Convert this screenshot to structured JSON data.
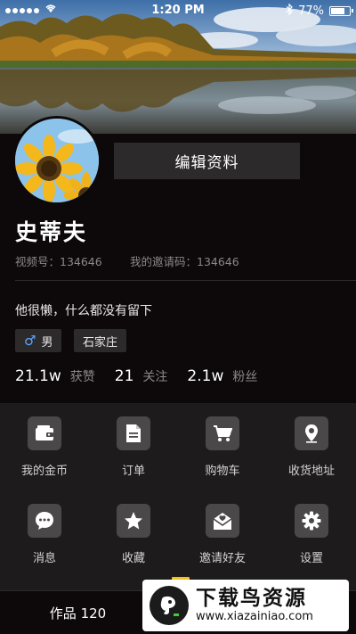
{
  "status_bar": {
    "time": "1:20 PM",
    "battery_text": "77%",
    "battery_level": 0.77,
    "icons": [
      "signal-icon",
      "wifi-icon",
      "bluetooth-icon",
      "battery-icon"
    ]
  },
  "profile": {
    "edit_button_label": "编辑资料",
    "username": "史蒂夫",
    "video_id": "视频号：134646",
    "invite_code": "我的邀请码：134646",
    "bio": "他很懒，什么都没有留下",
    "gender_label": "男",
    "city": "石家庄"
  },
  "stats": [
    {
      "value": "21.1w",
      "label": "获赞"
    },
    {
      "value": "21",
      "label": "关注"
    },
    {
      "value": "2.1w",
      "label": "粉丝"
    }
  ],
  "grid": [
    {
      "label": "我的金币",
      "icon": "wallet-icon"
    },
    {
      "label": "订单",
      "icon": "document-icon"
    },
    {
      "label": "购物车",
      "icon": "cart-icon"
    },
    {
      "label": "收货地址",
      "icon": "location-pin-icon"
    },
    {
      "label": "消息",
      "icon": "chat-bubble-icon"
    },
    {
      "label": "收藏",
      "icon": "star-icon"
    },
    {
      "label": "邀请好友",
      "icon": "invite-envelope-icon"
    },
    {
      "label": "设置",
      "icon": "gear-icon"
    }
  ],
  "tabs": {
    "works_label": "作品 120"
  },
  "watermark": {
    "title": "下载鸟资源",
    "url": "www.xiazainiao.com"
  },
  "colors": {
    "background": "#0d090b",
    "panel": "#1d1b1c",
    "icon_tile": "#4a4849",
    "accent": "#f3c11b",
    "gender_blue": "#5aa7ff"
  }
}
